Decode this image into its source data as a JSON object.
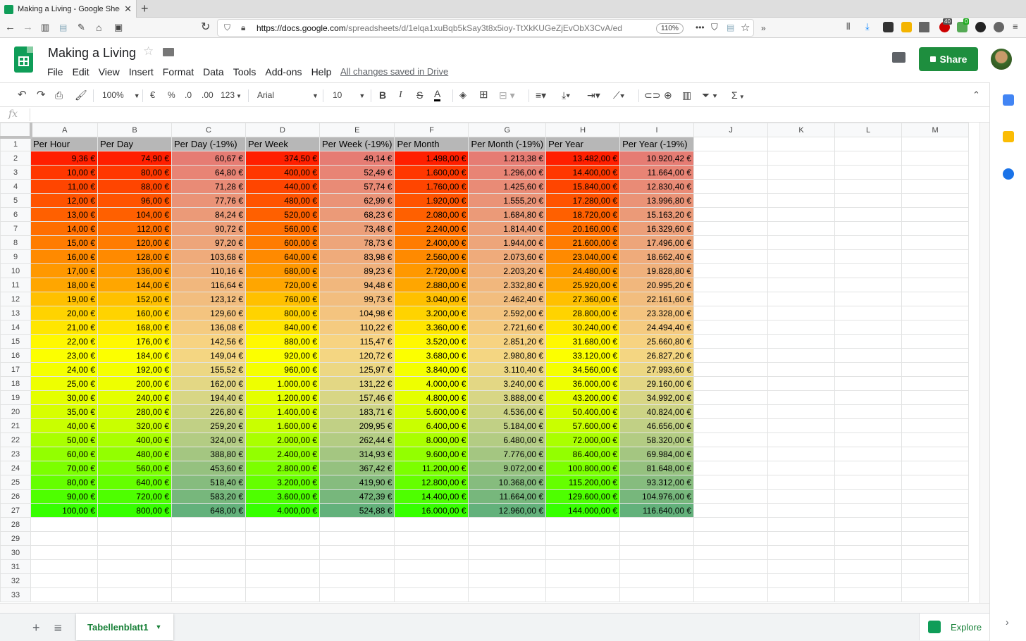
{
  "browser": {
    "tab_title": "Making a Living - Google Sheet",
    "tab_close": "✕",
    "new_tab": "+",
    "url_host": "https://docs.google.com",
    "url_path": "/spreadsheets/d/1elqa1xuBqb5kSay3t8x5ioy-TtXkKUGeZjEvObX3CvA/ed",
    "zoom": "110%",
    "more": "•••",
    "ext_badge_1": "40",
    "ext_badge_2": "0"
  },
  "doc": {
    "title": "Making a Living",
    "menus": [
      "File",
      "Edit",
      "View",
      "Insert",
      "Format",
      "Data",
      "Tools",
      "Add-ons",
      "Help"
    ],
    "saved_status": "All changes saved in Drive",
    "share_label": "Share"
  },
  "toolbar": {
    "zoom": "100%",
    "currency": "€",
    "percent": "%",
    "dec_less": ".0",
    "dec_more": ".00",
    "format_more": "123",
    "font": "Arial",
    "font_size": "10",
    "bold": "B",
    "italic": "I",
    "strike": "S",
    "text_color": "A",
    "sum": "Σ"
  },
  "formula_bar": {
    "fx": "fx"
  },
  "columns": [
    "A",
    "B",
    "C",
    "D",
    "E",
    "F",
    "G",
    "H",
    "I",
    "J",
    "K",
    "L",
    "M"
  ],
  "headers": [
    "Per Hour",
    "Per Day",
    "Per Day (-19%)",
    "Per Week",
    "Per Week (-19%)",
    "Per Month",
    "Per Month (-19%)",
    "Per Year",
    "Per Year (-19%)"
  ],
  "rows": [
    [
      "9,36 €",
      "74,90 €",
      "60,67 €",
      "374,50 €",
      "49,14 €",
      "1.498,00 €",
      "1.213,38 €",
      "13.482,00 €",
      "10.920,42 €"
    ],
    [
      "10,00 €",
      "80,00 €",
      "64,80 €",
      "400,00 €",
      "52,49 €",
      "1.600,00 €",
      "1.296,00 €",
      "14.400,00 €",
      "11.664,00 €"
    ],
    [
      "11,00 €",
      "88,00 €",
      "71,28 €",
      "440,00 €",
      "57,74 €",
      "1.760,00 €",
      "1.425,60 €",
      "15.840,00 €",
      "12.830,40 €"
    ],
    [
      "12,00 €",
      "96,00 €",
      "77,76 €",
      "480,00 €",
      "62,99 €",
      "1.920,00 €",
      "1.555,20 €",
      "17.280,00 €",
      "13.996,80 €"
    ],
    [
      "13,00 €",
      "104,00 €",
      "84,24 €",
      "520,00 €",
      "68,23 €",
      "2.080,00 €",
      "1.684,80 €",
      "18.720,00 €",
      "15.163,20 €"
    ],
    [
      "14,00 €",
      "112,00 €",
      "90,72 €",
      "560,00 €",
      "73,48 €",
      "2.240,00 €",
      "1.814,40 €",
      "20.160,00 €",
      "16.329,60 €"
    ],
    [
      "15,00 €",
      "120,00 €",
      "97,20 €",
      "600,00 €",
      "78,73 €",
      "2.400,00 €",
      "1.944,00 €",
      "21.600,00 €",
      "17.496,00 €"
    ],
    [
      "16,00 €",
      "128,00 €",
      "103,68 €",
      "640,00 €",
      "83,98 €",
      "2.560,00 €",
      "2.073,60 €",
      "23.040,00 €",
      "18.662,40 €"
    ],
    [
      "17,00 €",
      "136,00 €",
      "110,16 €",
      "680,00 €",
      "89,23 €",
      "2.720,00 €",
      "2.203,20 €",
      "24.480,00 €",
      "19.828,80 €"
    ],
    [
      "18,00 €",
      "144,00 €",
      "116,64 €",
      "720,00 €",
      "94,48 €",
      "2.880,00 €",
      "2.332,80 €",
      "25.920,00 €",
      "20.995,20 €"
    ],
    [
      "19,00 €",
      "152,00 €",
      "123,12 €",
      "760,00 €",
      "99,73 €",
      "3.040,00 €",
      "2.462,40 €",
      "27.360,00 €",
      "22.161,60 €"
    ],
    [
      "20,00 €",
      "160,00 €",
      "129,60 €",
      "800,00 €",
      "104,98 €",
      "3.200,00 €",
      "2.592,00 €",
      "28.800,00 €",
      "23.328,00 €"
    ],
    [
      "21,00 €",
      "168,00 €",
      "136,08 €",
      "840,00 €",
      "110,22 €",
      "3.360,00 €",
      "2.721,60 €",
      "30.240,00 €",
      "24.494,40 €"
    ],
    [
      "22,00 €",
      "176,00 €",
      "142,56 €",
      "880,00 €",
      "115,47 €",
      "3.520,00 €",
      "2.851,20 €",
      "31.680,00 €",
      "25.660,80 €"
    ],
    [
      "23,00 €",
      "184,00 €",
      "149,04 €",
      "920,00 €",
      "120,72 €",
      "3.680,00 €",
      "2.980,80 €",
      "33.120,00 €",
      "26.827,20 €"
    ],
    [
      "24,00 €",
      "192,00 €",
      "155,52 €",
      "960,00 €",
      "125,97 €",
      "3.840,00 €",
      "3.110,40 €",
      "34.560,00 €",
      "27.993,60 €"
    ],
    [
      "25,00 €",
      "200,00 €",
      "162,00 €",
      "1.000,00 €",
      "131,22 €",
      "4.000,00 €",
      "3.240,00 €",
      "36.000,00 €",
      "29.160,00 €"
    ],
    [
      "30,00 €",
      "240,00 €",
      "194,40 €",
      "1.200,00 €",
      "157,46 €",
      "4.800,00 €",
      "3.888,00 €",
      "43.200,00 €",
      "34.992,00 €"
    ],
    [
      "35,00 €",
      "280,00 €",
      "226,80 €",
      "1.400,00 €",
      "183,71 €",
      "5.600,00 €",
      "4.536,00 €",
      "50.400,00 €",
      "40.824,00 €"
    ],
    [
      "40,00 €",
      "320,00 €",
      "259,20 €",
      "1.600,00 €",
      "209,95 €",
      "6.400,00 €",
      "5.184,00 €",
      "57.600,00 €",
      "46.656,00 €"
    ],
    [
      "50,00 €",
      "400,00 €",
      "324,00 €",
      "2.000,00 €",
      "262,44 €",
      "8.000,00 €",
      "6.480,00 €",
      "72.000,00 €",
      "58.320,00 €"
    ],
    [
      "60,00 €",
      "480,00 €",
      "388,80 €",
      "2.400,00 €",
      "314,93 €",
      "9.600,00 €",
      "7.776,00 €",
      "86.400,00 €",
      "69.984,00 €"
    ],
    [
      "70,00 €",
      "560,00 €",
      "453,60 €",
      "2.800,00 €",
      "367,42 €",
      "11.200,00 €",
      "9.072,00 €",
      "100.800,00 €",
      "81.648,00 €"
    ],
    [
      "80,00 €",
      "640,00 €",
      "518,40 €",
      "3.200,00 €",
      "419,90 €",
      "12.800,00 €",
      "10.368,00 €",
      "115.200,00 €",
      "93.312,00 €"
    ],
    [
      "90,00 €",
      "720,00 €",
      "583,20 €",
      "3.600,00 €",
      "472,39 €",
      "14.400,00 €",
      "11.664,00 €",
      "129.600,00 €",
      "104.976,00 €"
    ],
    [
      "100,00 €",
      "800,00 €",
      "648,00 €",
      "4.000,00 €",
      "524,88 €",
      "16.000,00 €",
      "12.960,00 €",
      "144.000,00 €",
      "116.640,00 €"
    ]
  ],
  "row_count": 33,
  "strong_colors": [
    "#ff1f00",
    "#ff3700",
    "#ff4500",
    "#ff5300",
    "#ff6000",
    "#ff6e00",
    "#ff7c00",
    "#ff8a00",
    "#ff9800",
    "#ffa600",
    "#ffc000",
    "#ffd300",
    "#ffe600",
    "#fff800",
    "#fcff00",
    "#f5ff00",
    "#eeff00",
    "#e4ff00",
    "#d7ff00",
    "#c9ff00",
    "#aaff00",
    "#93ff00",
    "#7cff00",
    "#65ff00",
    "#4eff00",
    "#37ff00"
  ],
  "soft_colors": [
    "#e67c73",
    "#e88475",
    "#e98b76",
    "#ea9377",
    "#eb9a78",
    "#ec9f79",
    "#eda57a",
    "#efab7b",
    "#f0b17c",
    "#f1b77d",
    "#f2bd7e",
    "#f4c47f",
    "#f5cb80",
    "#f7d381",
    "#f4d682",
    "#ecd783",
    "#e3d784",
    "#d8d685",
    "#cdd485",
    "#c1d085",
    "#b3cc83",
    "#a4c681",
    "#95c17f",
    "#86bc7e",
    "#77b77c",
    "#63b17b"
  ],
  "header_color": "#b7b7b7",
  "bottom": {
    "add": "+",
    "sheet_name": "Tabellenblatt1",
    "sheet_dd": "▼",
    "explore": "Explore"
  },
  "side": {
    "expand": "›"
  }
}
